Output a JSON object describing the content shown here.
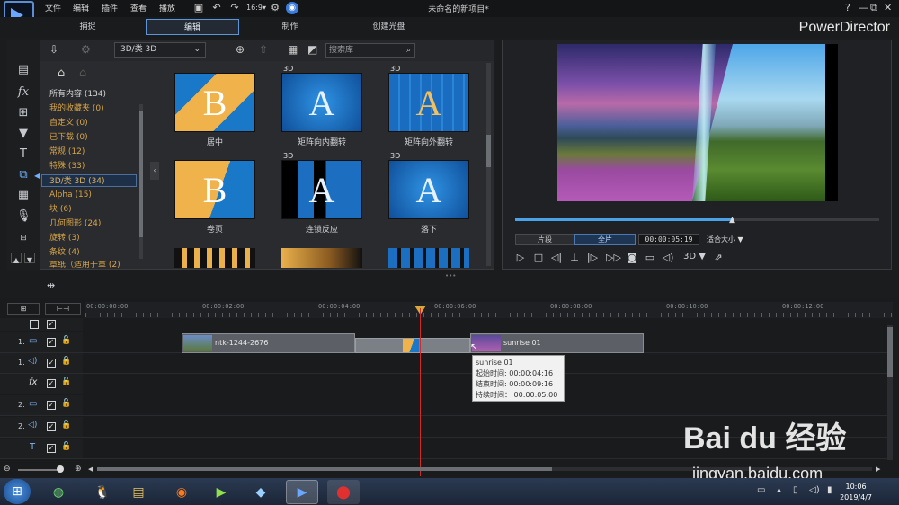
{
  "window": {
    "title": "未命名的新项目*",
    "brand": "PowerDirector",
    "help": "?",
    "min": "—",
    "restore": "⧉",
    "close": "✕"
  },
  "menu": [
    "文件",
    "编辑",
    "插件",
    "查看",
    "播放"
  ],
  "modes": [
    {
      "label": "捕捉"
    },
    {
      "label": "编辑",
      "active": true
    },
    {
      "label": "制作"
    },
    {
      "label": "创建光盘"
    }
  ],
  "library": {
    "dropdown": "3D/类 3D",
    "search_placeholder": "搜索库",
    "categories": [
      {
        "label": "所有内容 (134)"
      },
      {
        "label": "我的收藏夹 (0)"
      },
      {
        "label": "自定义 (0)"
      },
      {
        "label": "已下载 (0)"
      },
      {
        "label": "常规 (12)"
      },
      {
        "label": "特殊 (33)"
      },
      {
        "label": "3D/类 3D (34)",
        "selected": true
      },
      {
        "label": "Alpha (15)"
      },
      {
        "label": "块 (6)"
      },
      {
        "label": "几何图形 (24)"
      },
      {
        "label": "旋转 (3)"
      },
      {
        "label": "条纹 (4)"
      },
      {
        "label": "章纸（适用于章 (2)"
      }
    ],
    "thumbs": [
      {
        "label": "居中",
        "badge": "",
        "letter": "B"
      },
      {
        "label": "矩阵向内翻转",
        "badge": "3D",
        "letter": "A"
      },
      {
        "label": "矩阵向外翻转",
        "badge": "3D",
        "letter": "A"
      },
      {
        "label": "卷页",
        "badge": "",
        "letter": "B"
      },
      {
        "label": "连锁反应",
        "badge": "3D",
        "letter": "A"
      },
      {
        "label": "落下",
        "badge": "3D",
        "letter": "A"
      }
    ],
    "row3_badges": [
      "",
      "3D",
      "3D"
    ]
  },
  "preview": {
    "clip_btn": "片段",
    "full_btn": "全片",
    "timecode": "00:00:05:19",
    "fit": "适合大小 ▼",
    "mode3d": "3D ▼",
    "scrub_progress": 0.6
  },
  "timeline": {
    "ruler": [
      "00:00:00:00",
      "00:00:02:00",
      "00:00:04:00",
      "00:00:06:00",
      "00:00:08:00",
      "00:00:10:00",
      "00:00:12:00"
    ],
    "tracks": [
      {
        "num": "1.",
        "icon": "▭"
      },
      {
        "num": "1.",
        "icon": "◁)"
      },
      {
        "num": "",
        "icon": "fx"
      },
      {
        "num": "2.",
        "icon": "▭"
      },
      {
        "num": "2.",
        "icon": "◁)"
      },
      {
        "num": "",
        "icon": "T"
      }
    ],
    "clip1": "ntk-1244-2676",
    "clip2": "sunrise 01",
    "tooltip": {
      "title": "sunrise 01",
      "start": "起始时间: 00:00:04:16",
      "end": "结束时间: 00:00:09:16",
      "dur": "持续时间： 00:00:05:00"
    }
  },
  "taskbar": {
    "time": "10:06",
    "date": "2019/4/7"
  },
  "watermark": {
    "brand": "Bai du 经验",
    "url": "jingyan.baidu.com"
  }
}
